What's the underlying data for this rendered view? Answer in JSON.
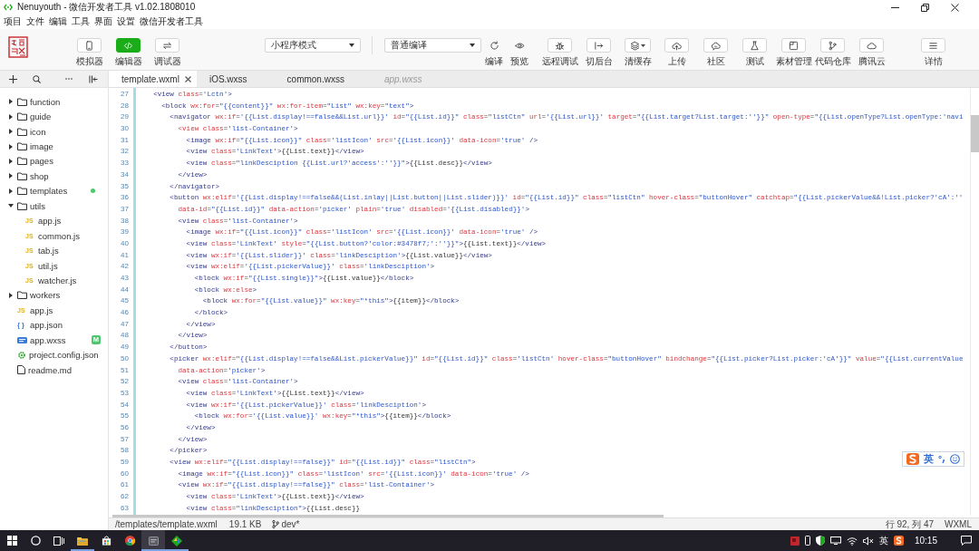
{
  "window": {
    "title": "Nenuyouth - 微信开发者工具 v1.02.1808010"
  },
  "menu": [
    "项目",
    "文件",
    "编辑",
    "工具",
    "界面",
    "设置",
    "微信开发者工具"
  ],
  "toolbar": {
    "views": [
      {
        "label": "模拟器",
        "kind": "simulator",
        "selected": false
      },
      {
        "label": "编辑器",
        "kind": "editor",
        "selected": true
      },
      {
        "label": "调试器",
        "kind": "debugger",
        "selected": false
      }
    ],
    "mode_select": {
      "value": "小程序模式"
    },
    "compile_select": {
      "value": "普通编译"
    },
    "run_actions": [
      {
        "label": "编译",
        "kind": "compile"
      },
      {
        "label": "预览",
        "kind": "preview"
      }
    ],
    "actions": [
      {
        "label": "远程调试",
        "kind": "remote",
        "dropdown": false
      },
      {
        "label": "切后台",
        "kind": "background",
        "dropdown": false
      },
      {
        "label": "清缓存",
        "kind": "cache",
        "dropdown": true
      },
      {
        "label": "上传",
        "kind": "upload",
        "dropdown": false
      },
      {
        "label": "社区",
        "kind": "community",
        "dropdown": false
      },
      {
        "label": "测试",
        "kind": "test",
        "dropdown": false
      },
      {
        "label": "素材管理",
        "kind": "assets",
        "dropdown": false
      },
      {
        "label": "代码仓库",
        "kind": "repo",
        "dropdown": false
      },
      {
        "label": "腾讯云",
        "kind": "cloud",
        "dropdown": false
      }
    ],
    "details": {
      "label": "详情"
    }
  },
  "sidebar": {
    "tree": [
      {
        "name": "function",
        "kind": "folder",
        "expanded": false,
        "modified": false
      },
      {
        "name": "guide",
        "kind": "folder",
        "expanded": false,
        "modified": false
      },
      {
        "name": "icon",
        "kind": "folder",
        "expanded": false,
        "modified": false
      },
      {
        "name": "image",
        "kind": "folder",
        "expanded": false,
        "modified": false
      },
      {
        "name": "pages",
        "kind": "folder",
        "expanded": false,
        "modified": false
      },
      {
        "name": "shop",
        "kind": "folder",
        "expanded": false,
        "modified": false
      },
      {
        "name": "templates",
        "kind": "folder",
        "expanded": false,
        "modified": true
      },
      {
        "name": "utils",
        "kind": "folder",
        "expanded": true,
        "modified": false,
        "children": [
          {
            "name": "app.js",
            "kind": "js",
            "glyph": "JS",
            "modified": false
          },
          {
            "name": "common.js",
            "kind": "js",
            "glyph": "JS",
            "modified": false
          },
          {
            "name": "tab.js",
            "kind": "js",
            "glyph": "JS",
            "modified": false
          },
          {
            "name": "util.js",
            "kind": "js",
            "glyph": "JS",
            "modified": false
          },
          {
            "name": "watcher.js",
            "kind": "js",
            "glyph": "JS",
            "modified": false
          }
        ]
      },
      {
        "name": "workers",
        "kind": "folder",
        "expanded": false,
        "modified": false
      },
      {
        "name": "app.js",
        "kind": "js",
        "glyph": "JS",
        "modified": false
      },
      {
        "name": "app.json",
        "kind": "json",
        "glyph": "{ }",
        "modified": false
      },
      {
        "name": "app.wxss",
        "kind": "wxss",
        "modified": false,
        "badge": "M"
      },
      {
        "name": "project.config.json",
        "kind": "config",
        "modified": false
      },
      {
        "name": "readme.md",
        "kind": "markdown",
        "modified": false
      }
    ]
  },
  "editor": {
    "tabs": [
      {
        "label": "template.wxml",
        "selected": true,
        "preview": false
      },
      {
        "label": "iOS.wxss",
        "selected": false,
        "preview": false
      },
      {
        "label": "common.wxss",
        "selected": false,
        "preview": false
      },
      {
        "label": "app.wxss",
        "selected": false,
        "preview": true
      }
    ],
    "lines": [
      {
        "number": "27",
        "code": "  <view class='Lctn'>"
      },
      {
        "number": "28",
        "code": "    <block wx:for=\"{{content}}\" wx:for-item=\"List\" wx:key=\"text\">"
      },
      {
        "number": "29",
        "code": "      <navigator wx:if='{{List.display!==false&&List.url}}' id=\"{{List.id}}\" class=\"listCtn\" url='{{List.url}}' target=\"{{List.target?List.target:''}}\" open-type=\"{{List.openType?List.openType:'navi"
      },
      {
        "number": "30",
        "code": "        <view class='list-Container'>"
      },
      {
        "number": "31",
        "code": "          <image wx:if=\"{{List.icon}}\" class='listIcon' src='{{List.icon}}' data-icon='true' />"
      },
      {
        "number": "32",
        "code": "          <view class='LinkText'>{{List.text}}</view>"
      },
      {
        "number": "33",
        "code": "          <view class=\"linkDesciption {{List.url?'access':''}}\">{{List.desc}}</view>"
      },
      {
        "number": "34",
        "code": "        </view>"
      },
      {
        "number": "35",
        "code": "      </navigator>"
      },
      {
        "number": "36",
        "code": "      <button wx:elif='{{List.display!==false&&(List.inlay||List.button||List.slider)}}' id=\"{{List.id}}\" class=\"listCtn\" hover-class=\"buttonHover\" catchtap=\"{{List.pickerValue&&!List.picker?'cA':''"
      },
      {
        "number": "37",
        "code": "        data-id=\"{{List.id}}\" data-action='picker' plain='true' disabled='{{List.disabled}}'>"
      },
      {
        "number": "38",
        "code": "        <view class='list-Container'>"
      },
      {
        "number": "39",
        "code": "          <image wx:if=\"{{List.icon}}\" class='listIcon' src='{{List.icon}}' data-icon='true' />"
      },
      {
        "number": "40",
        "code": "          <view class='LinkText' style=\"{{List.button?'color:#3478f7;':''}}\">{{List.text}}</view>"
      },
      {
        "number": "41",
        "code": "          <view wx:if='{{List.slider}}' class='linkDesciption'>{{List.value}}</view>"
      },
      {
        "number": "42",
        "code": "          <view wx:elif='{{List.pickerValue}}' class='linkDesciption'>"
      },
      {
        "number": "43",
        "code": "            <block wx:if=\"{{List.single}}\">{{List.value}}</block>"
      },
      {
        "number": "44",
        "code": "            <block wx:else>"
      },
      {
        "number": "45",
        "code": "              <block wx:for=\"{{List.value}}\" wx:key=\"*this\">{{item}}</block>"
      },
      {
        "number": "46",
        "code": "            </block>"
      },
      {
        "number": "47",
        "code": "          </view>"
      },
      {
        "number": "48",
        "code": "        </view>"
      },
      {
        "number": "49",
        "code": "      </button>"
      },
      {
        "number": "50",
        "code": "      <picker wx:elif=\"{{List.display!==false&&List.pickerValue}}\" id=\"{{List.id}}\" class='listCtn' hover-class=\"buttonHover\" bindchange=\"{{List.picker?List.picker:'cA'}}\" value=\"{{List.currentValue"
      },
      {
        "number": "51",
        "code": "        data-action='picker'>"
      },
      {
        "number": "52",
        "code": "        <view class='list-Container'>"
      },
      {
        "number": "53",
        "code": "          <view class='LinkText'>{{List.text}}</view>"
      },
      {
        "number": "54",
        "code": "          <view wx:if='{{List.pickerValue}}' class='linkDesciption'>"
      },
      {
        "number": "55",
        "code": "            <block wx:for='{{List.value}}' wx:key=\"*this\">{{item}}</block>"
      },
      {
        "number": "56",
        "code": "          </view>"
      },
      {
        "number": "57",
        "code": "        </view>"
      },
      {
        "number": "58",
        "code": "      </picker>"
      },
      {
        "number": "59",
        "code": "      <view wx:elif=\"{{List.display!==false}}\" id=\"{{List.id}}\" class=\"listCtn\">"
      },
      {
        "number": "60",
        "code": "        <image wx:if=\"{{List.icon}}\" class='listIcon' src='{{List.icon}}' data-icon='true' />"
      },
      {
        "number": "61",
        "code": "        <view wx:if=\"{{List.display!==false}}\" class='list-Container'>"
      },
      {
        "number": "62",
        "code": "          <view class='LinkText'>{{List.text}}</view>"
      },
      {
        "number": "63",
        "code": "          <view class=\"linkDesciption\">{{List.desc}}"
      }
    ]
  },
  "ime_toolbar": {
    "mode": "英"
  },
  "status_bar": {
    "path": "/templates/template.wxml",
    "size": "19.1 KB",
    "branch": "dev*",
    "cursor": "行 92, 列 47",
    "language": "WXML"
  },
  "taskbar": {
    "apps": [
      {
        "kind": "files",
        "active": false,
        "running": true
      },
      {
        "kind": "store",
        "active": false,
        "running": false
      },
      {
        "kind": "browser",
        "active": false,
        "running": false
      },
      {
        "kind": "window",
        "active": true,
        "running": true
      },
      {
        "kind": "devtool",
        "active": false,
        "running": true
      }
    ],
    "input_mode": "英",
    "time": "10:15"
  }
}
